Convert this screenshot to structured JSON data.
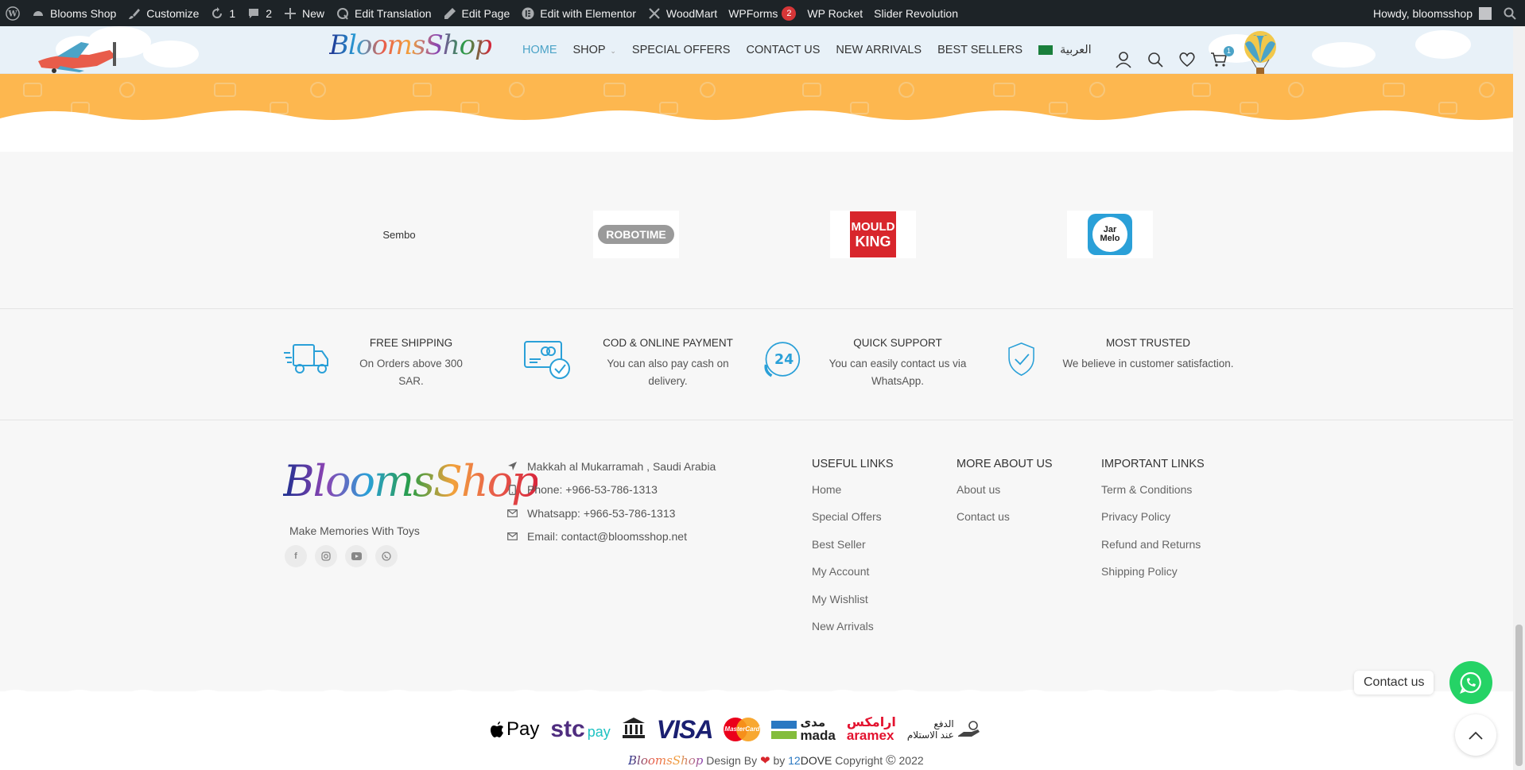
{
  "admin_bar": {
    "site_name": "Blooms Shop",
    "customize": "Customize",
    "updates_count": "1",
    "comments_count": "2",
    "new": "New",
    "edit_translation": "Edit Translation",
    "edit_page": "Edit Page",
    "edit_elementor": "Edit with Elementor",
    "woodmart": "WoodMart",
    "wpforms": "WPForms",
    "wpforms_badge": "2",
    "wp_rocket": "WP Rocket",
    "slider_revolution": "Slider Revolution",
    "howdy": "Howdy, bloomsshop"
  },
  "header": {
    "logo_text": "BloomsShop",
    "nav": [
      {
        "label": "HOME",
        "active": true
      },
      {
        "label": "SHOP",
        "active": false
      },
      {
        "label": "SPECIAL OFFERS",
        "active": false
      },
      {
        "label": "CONTACT US",
        "active": false
      },
      {
        "label": "NEW ARRIVALS",
        "active": false
      },
      {
        "label": "BEST SELLERS",
        "active": false
      }
    ],
    "language_label": "العربية",
    "cart_count": "1"
  },
  "brands": {
    "items": [
      {
        "name": "Sembo",
        "type": "text"
      },
      {
        "name": "ROBOTIME",
        "type": "logo"
      },
      {
        "name_line1": "MOULD",
        "name_line2": "KING",
        "type": "logo"
      },
      {
        "name_line1": "Jar",
        "name_line2": "Melo",
        "type": "logo"
      }
    ]
  },
  "features": [
    {
      "title": "FREE SHIPPING",
      "desc": "On Orders above 300 SAR.",
      "icon": "truck-icon"
    },
    {
      "title": "COD & ONLINE PAYMENT",
      "desc": "You can also pay cash on delivery.",
      "icon": "payment-card-icon"
    },
    {
      "title": "QUICK SUPPORT",
      "desc_line1": "You can easily contact us via",
      "desc_line2": "WhatsApp.",
      "badge": "24",
      "icon": "support-24-icon"
    },
    {
      "title": "MOST TRUSTED",
      "desc": "We believe in customer satisfaction.",
      "icon": "shield-check-icon"
    }
  ],
  "footer": {
    "logo_text": "BloomsShop",
    "tagline": "Make Memories With Toys",
    "contact": {
      "address": "Makkah al Mukarramah , Saudi Arabia",
      "phone": "Phone: +966-53-786-1313",
      "whatsapp": "Whatsapp: +966-53-786-1313",
      "email": "Email: contact@bloomsshop.net"
    },
    "useful_links": {
      "title": "USEFUL LINKS",
      "links": [
        "Home",
        "Special Offers",
        "Best Seller",
        "My Account",
        "My Wishlist",
        "New Arrivals"
      ]
    },
    "more_about": {
      "title": "MORE ABOUT US",
      "links": [
        "About us",
        "Contact us"
      ]
    },
    "important_links": {
      "title": "IMPORTANT LINKS",
      "links": [
        "Term & Conditions",
        "Privacy Policy",
        "Refund and Returns",
        "Shipping Policy"
      ]
    }
  },
  "payments": {
    "apple_pay": "Pay",
    "stc": "stc",
    "stc_pay": "pay",
    "visa": "VISA",
    "mastercard": "MasterCard",
    "mada_ar": "مدى",
    "mada": "mada",
    "aramex_ar": "ارامكس",
    "aramex": "aramex",
    "cod_ar_line1": "الدفع",
    "cod_ar_line2": "عند الاستلام"
  },
  "copyright": {
    "logo": "BloomsShop",
    "design_by": "Design By",
    "by": "by",
    "company_num": "12",
    "company_name": "DOVE",
    "text": "Copyright",
    "year": "2022"
  },
  "floating": {
    "contact_label": "Contact us"
  },
  "colors": {
    "accent": "#4ba3c7",
    "orange": "#fdb74f",
    "whatsapp": "#25d366",
    "admin_bar": "#1d2327"
  }
}
